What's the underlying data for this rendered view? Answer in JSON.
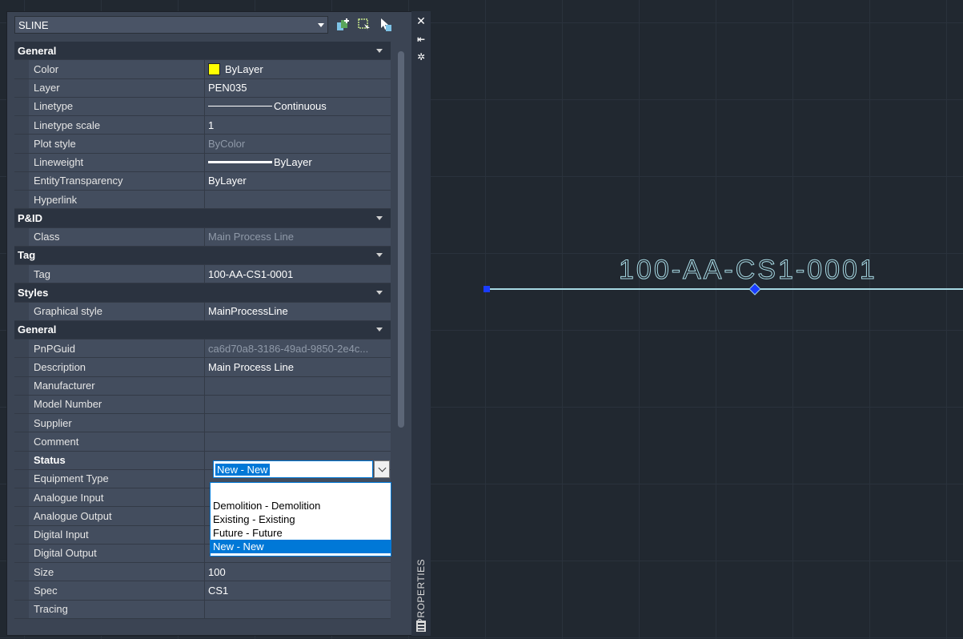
{
  "canvas": {
    "tag_text": "100-AA-CS1-0001"
  },
  "palette": {
    "title": "PROPERTIES",
    "close_glyph": "✕",
    "pin_glyph": "⇤",
    "settings_glyph": "✲",
    "object_type": "SLINE",
    "scrollbar": true
  },
  "categories": [
    {
      "label": "General",
      "rows": [
        {
          "name": "Color",
          "value": "ByLayer",
          "kind": "color"
        },
        {
          "name": "Layer",
          "value": "PEN035"
        },
        {
          "name": "Linetype",
          "value": "Continuous",
          "kind": "linetype"
        },
        {
          "name": "Linetype scale",
          "value": "1"
        },
        {
          "name": "Plot style",
          "value": "ByColor",
          "dim": true
        },
        {
          "name": "Lineweight",
          "value": "ByLayer",
          "kind": "lineweight"
        },
        {
          "name": "EntityTransparency",
          "value": "ByLayer"
        },
        {
          "name": "Hyperlink",
          "value": ""
        }
      ]
    },
    {
      "label": "P&ID",
      "rows": [
        {
          "name": "Class",
          "value": "Main Process Line",
          "dim": true
        }
      ]
    },
    {
      "label": "Tag",
      "rows": [
        {
          "name": "Tag",
          "value": "100-AA-CS1-0001"
        }
      ]
    },
    {
      "label": "Styles",
      "rows": [
        {
          "name": "Graphical style",
          "value": "MainProcessLine"
        }
      ]
    },
    {
      "label": "General",
      "rows": [
        {
          "name": "PnPGuid",
          "value": "ca6d70a8-3186-49ad-9850-2e4c...",
          "dim": true
        },
        {
          "name": "Description",
          "value": "Main Process Line"
        },
        {
          "name": "Manufacturer",
          "value": ""
        },
        {
          "name": "Model Number",
          "value": ""
        },
        {
          "name": "Supplier",
          "value": ""
        },
        {
          "name": "Comment",
          "value": ""
        },
        {
          "name": "Status",
          "value": "",
          "bold": true
        },
        {
          "name": "Equipment Type",
          "value": ""
        },
        {
          "name": "Analogue Input",
          "value": ""
        },
        {
          "name": "Analogue Output",
          "value": ""
        },
        {
          "name": "Digital Input",
          "value": ""
        },
        {
          "name": "Digital Output",
          "value": ""
        },
        {
          "name": "Size",
          "value": "100"
        },
        {
          "name": "Spec",
          "value": "CS1"
        },
        {
          "name": "Tracing",
          "value": ""
        }
      ]
    }
  ],
  "status_editor": {
    "value": "New - New",
    "options": [
      "Demolition - Demolition",
      "Existing - Existing",
      "Future - Future",
      "New - New"
    ],
    "selected": "New - New"
  },
  "colors": {
    "layer_color": "#ffff00",
    "line_color": "#a7d9e3",
    "grip_color": "#1a3cff",
    "selection": "#0078d7"
  },
  "icons": [
    "quick-select-icon",
    "select-objects-icon",
    "toggle-pickadd-icon",
    "close-icon",
    "pin-icon",
    "settings-icon",
    "properties-icon"
  ]
}
